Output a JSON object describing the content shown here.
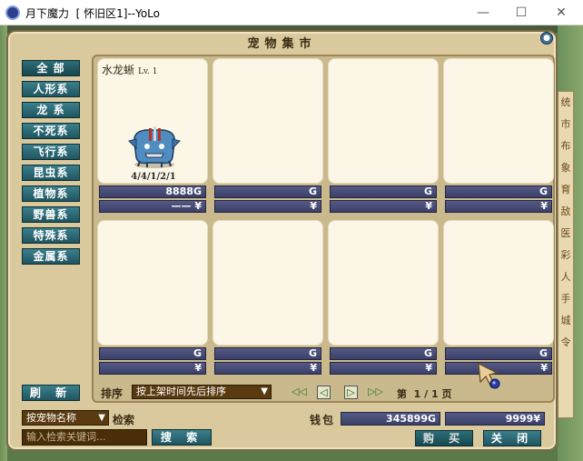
{
  "window": {
    "title": "月下魔力  [ 怀旧区1]--YoLo",
    "minimize_glyph": "—",
    "maximize_glyph": "☐",
    "close_glyph": "✕"
  },
  "panel": {
    "title": "宠物集市",
    "close_glyph": "●"
  },
  "categories": [
    {
      "label": "全 部",
      "active": true
    },
    {
      "label": "人形系"
    },
    {
      "label": "龙  系"
    },
    {
      "label": "不死系"
    },
    {
      "label": "飞行系"
    },
    {
      "label": "昆虫系"
    },
    {
      "label": "植物系"
    },
    {
      "label": "野兽系"
    },
    {
      "label": "特殊系"
    },
    {
      "label": "金属系"
    }
  ],
  "refresh_label": "刷 新",
  "slots": [
    {
      "name": "水龙蜥",
      "level": "Lv. 1",
      "stats": "4/4/1/2/1",
      "price": "8888G",
      "currency_value": "—— ¥",
      "has_pet": true
    },
    {
      "price": "G",
      "currency_value": "¥"
    },
    {
      "price": "G",
      "currency_value": "¥"
    },
    {
      "price": "G",
      "currency_value": "¥"
    },
    {
      "price": "G",
      "currency_value": "¥"
    },
    {
      "price": "G",
      "currency_value": "¥"
    },
    {
      "price": "G",
      "currency_value": "¥"
    },
    {
      "price": "G",
      "currency_value": "¥"
    }
  ],
  "sort": {
    "label": "排序",
    "selected": "按上架时间先后排序"
  },
  "pager": {
    "first": "◁◁",
    "prev": "◁",
    "next": "▷",
    "last": "▷▷",
    "info": "第  1 / 1 页"
  },
  "search": {
    "filter_selected": "按宠物名称",
    "label": "检索",
    "placeholder": "输入检索关键词...",
    "button": "搜 索"
  },
  "wallet": {
    "label": "钱包",
    "gold": "345899G",
    "yuan": "9999¥"
  },
  "buy_label": "购 买",
  "close_label": "关 闭",
  "right_strip_chars": [
    "统",
    "市",
    "布",
    "象",
    "育",
    "敌",
    "医",
    "彩",
    "人",
    "手",
    "城",
    "令"
  ],
  "colors": {
    "panel_bg": "#d9c99d",
    "button_teal": "#1f5560",
    "bar_blue": "#3b4068",
    "select_brown": "#5a3a10"
  }
}
